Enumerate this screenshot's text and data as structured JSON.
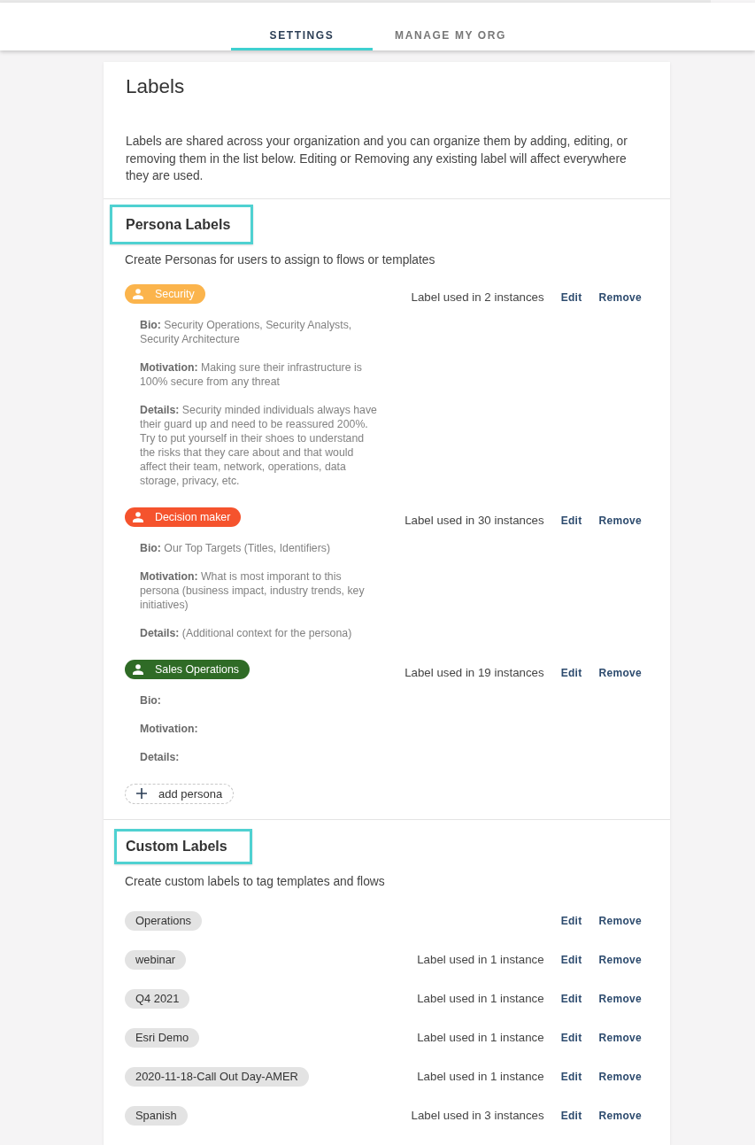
{
  "top_tabs": [
    {
      "label": "SETTINGS",
      "selected": true
    },
    {
      "label": "MANAGE MY ORG",
      "selected": false
    }
  ],
  "panel": {
    "title": "Labels",
    "description": "Labels are shared across your organization and you can organize them by adding, editing, or removing them in the list below. Editing or Removing any existing label will affect everywhere they are used."
  },
  "persona_labels": {
    "heading": "Persona Labels",
    "subtitle": "Create Personas for users to assign to flows or templates",
    "personas": [
      {
        "name": "Security",
        "color": "#fbb44c",
        "usage": "Label used in 2 instances",
        "edit": "Edit",
        "remove": "Remove",
        "fields": [
          {
            "label": "Bio:",
            "value": "Security Operations, Security Analysts, Security Architecture"
          },
          {
            "label": "Motivation:",
            "value": "Making sure their infrastructure is 100% secure from any threat"
          },
          {
            "label": "Details:",
            "value": "Security minded individuals always have their guard up and need to be reassured 200%. Try to put yourself in their shoes to understand the risks that they care about and that would affect their team, network, operations, data storage, privacy, etc."
          }
        ]
      },
      {
        "name": "Decision maker",
        "color": "#f5532d",
        "usage": "Label used in 30 instances",
        "edit": "Edit",
        "remove": "Remove",
        "fields": [
          {
            "label": "Bio:",
            "value": "Our Top Targets (Titles, Identifiers)"
          },
          {
            "label": "Motivation:",
            "value": "What is most imporant to this persona (business impact, industry trends, key initiatives)"
          },
          {
            "label": "Details:",
            "value": "(Additional context for the persona)"
          }
        ]
      },
      {
        "name": "Sales Operations",
        "color": "#2f6b26",
        "usage": "Label used in 19 instances",
        "edit": "Edit",
        "remove": "Remove",
        "fields": [
          {
            "label": "Bio:"
          },
          {
            "label": "Motivation:"
          },
          {
            "label": "Details:"
          }
        ]
      }
    ],
    "add_button": "add persona"
  },
  "custom_labels": {
    "heading": "Custom Labels",
    "subtitle": "Create custom labels to tag templates and flows",
    "labels": [
      {
        "name": "Operations",
        "edit": "Edit",
        "remove": "Remove"
      },
      {
        "name": "webinar",
        "usage": "Label used in 1 instance",
        "edit": "Edit",
        "remove": "Remove"
      },
      {
        "name": "Q4 2021",
        "usage": "Label used in 1 instance",
        "edit": "Edit",
        "remove": "Remove"
      },
      {
        "name": "Esri Demo",
        "usage": "Label used in 1 instance",
        "edit": "Edit",
        "remove": "Remove"
      },
      {
        "name": "2020-11-18-Call Out Day-AMER",
        "usage": "Label used in 1 instance",
        "edit": "Edit",
        "remove": "Remove"
      },
      {
        "name": "Spanish",
        "usage": "Label used in 3 instances",
        "edit": "Edit",
        "remove": "Remove"
      }
    ]
  }
}
